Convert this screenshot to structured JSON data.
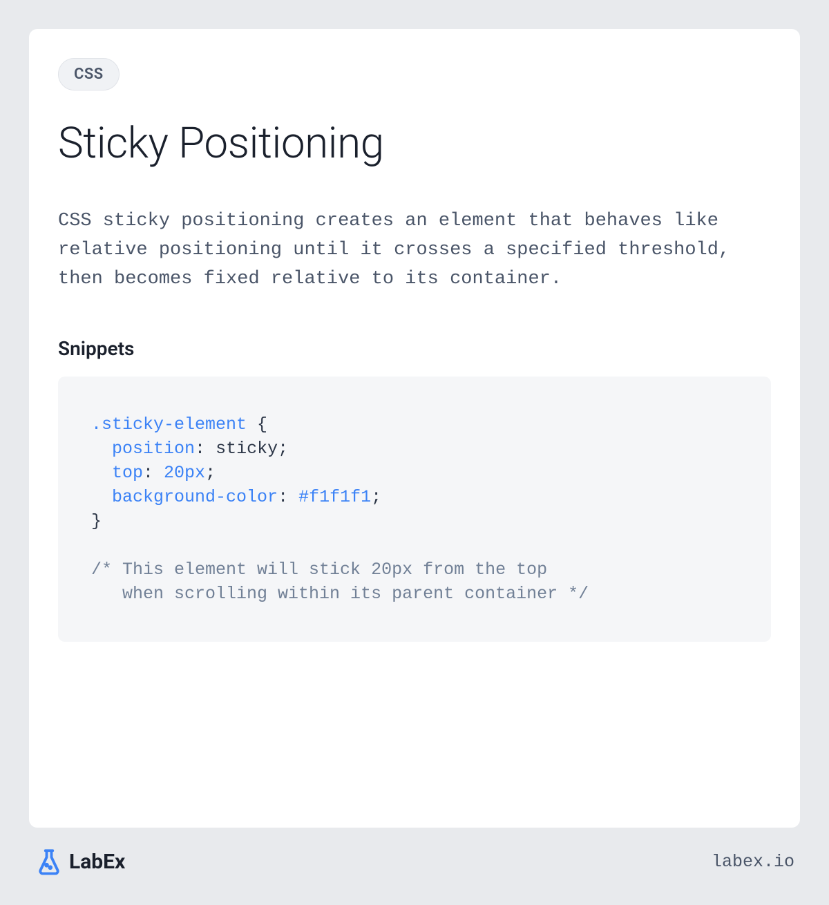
{
  "badge": "CSS",
  "title": "Sticky Positioning",
  "description": "CSS sticky positioning creates an element that behaves like relative positioning until it crosses a specified threshold, then becomes fixed relative to its container.",
  "snippets_heading": "Snippets",
  "code": {
    "selector": ".sticky-element",
    "rules": [
      {
        "property": "position",
        "value": "sticky",
        "type": "keyword"
      },
      {
        "property": "top",
        "value": "20px",
        "type": "number"
      },
      {
        "property": "background-color",
        "value": "#f1f1f1",
        "type": "color"
      }
    ],
    "comment_line1": "/* This element will stick 20px from the top",
    "comment_line2": "   when scrolling within its parent container */"
  },
  "footer": {
    "logo_text": "LabEx",
    "url": "labex.io"
  }
}
